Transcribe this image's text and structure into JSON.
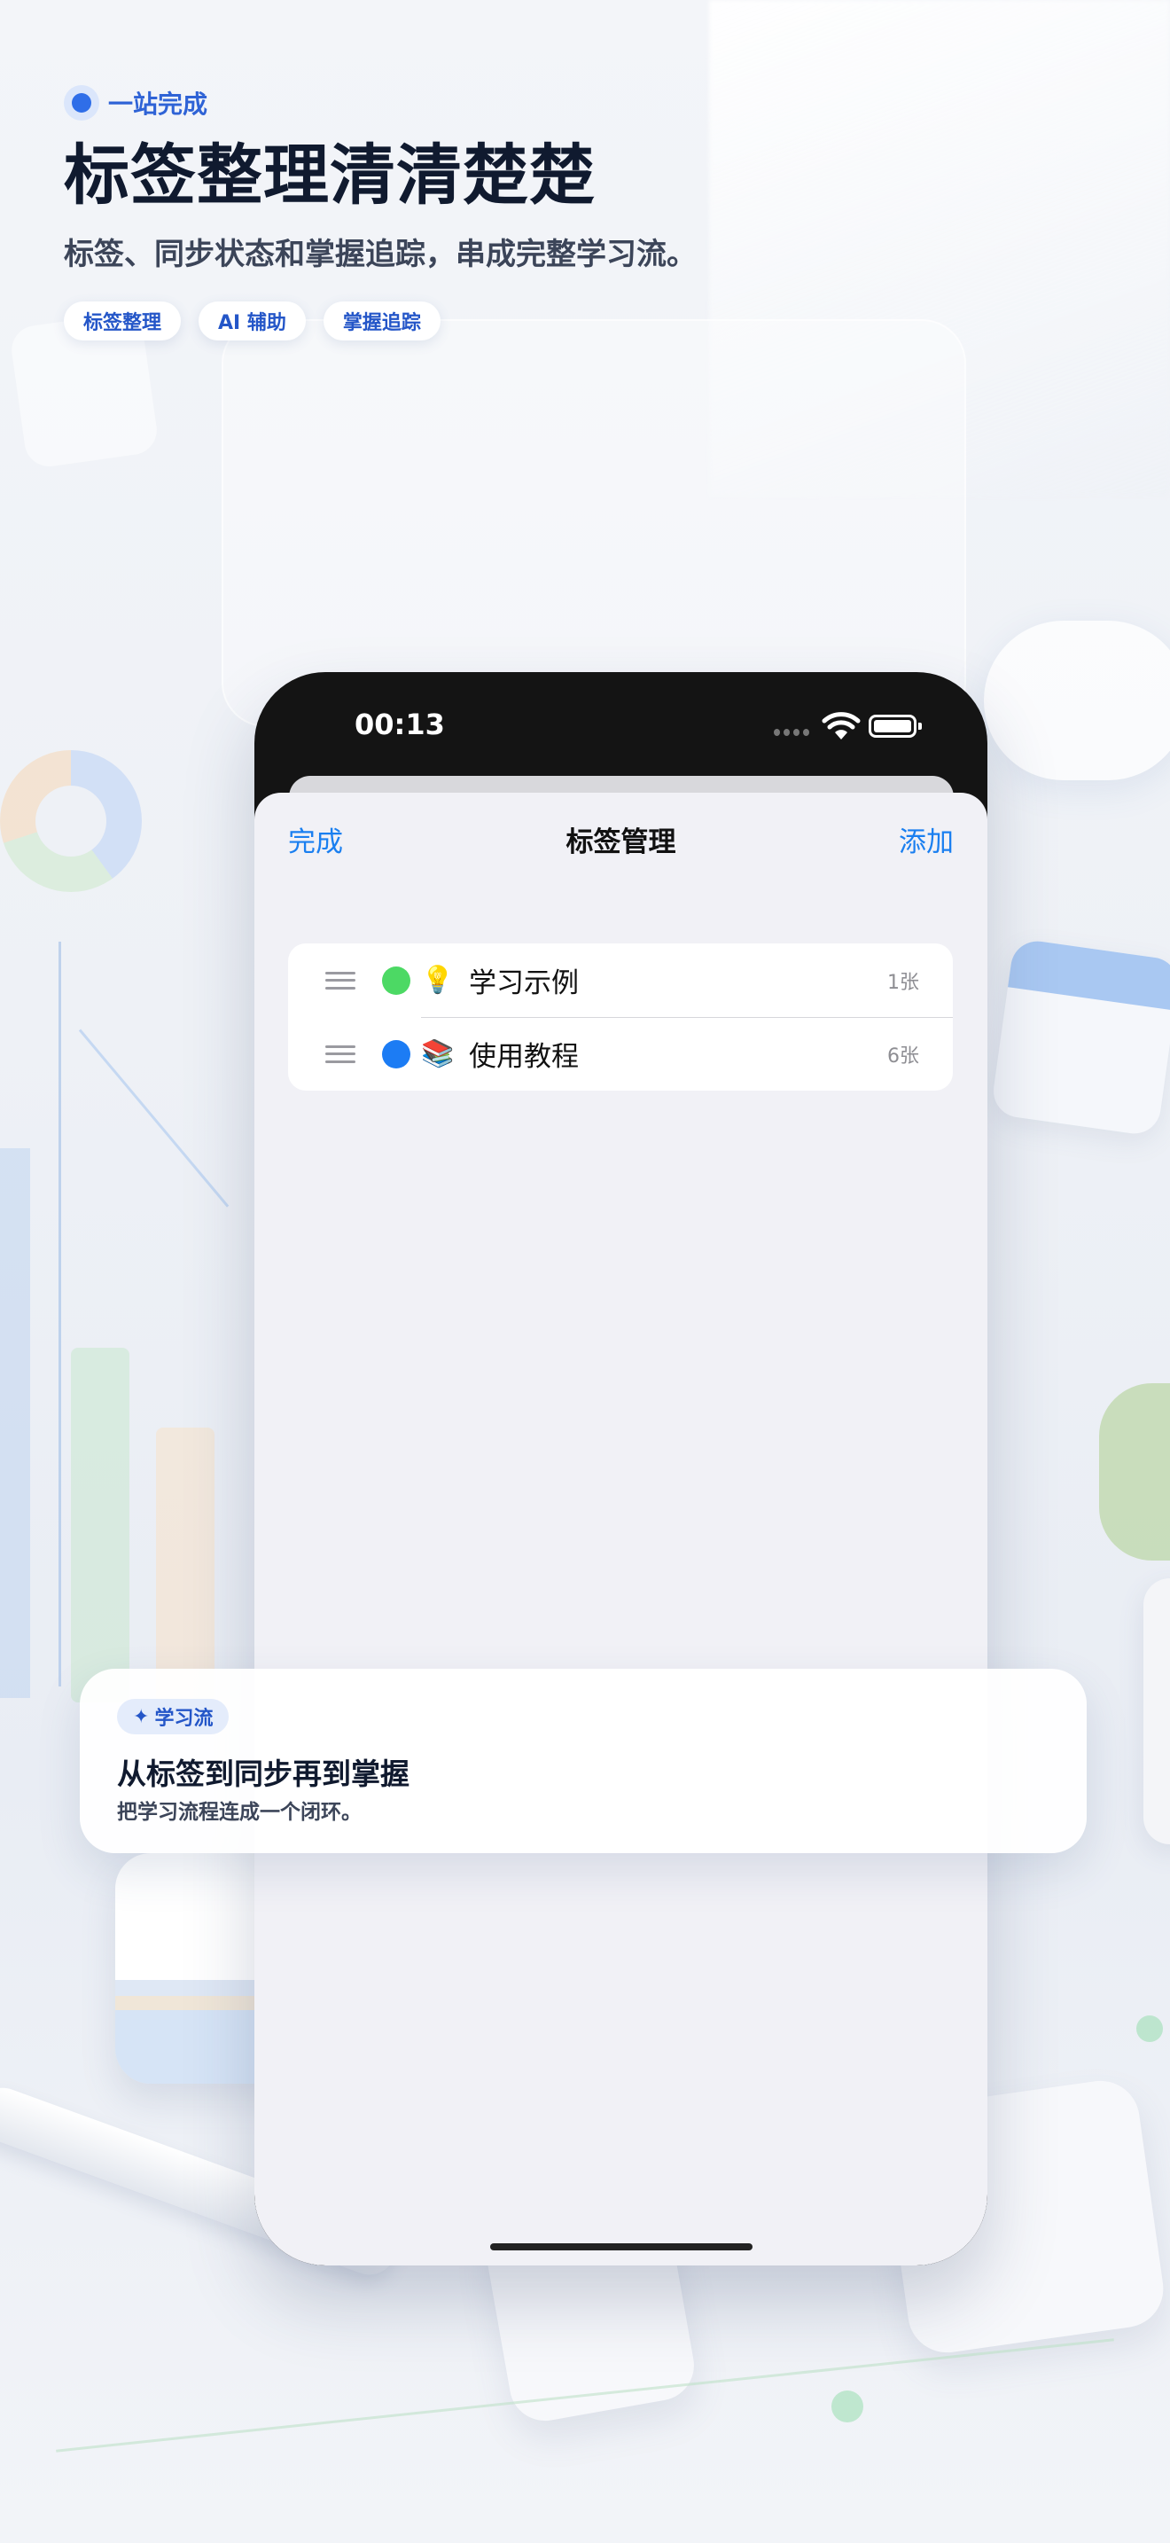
{
  "header": {
    "kicker": "一站完成",
    "headline": "标签整理清清楚楚",
    "subline": "标签、同步状态和掌握追踪，串成完整学习流。",
    "chips": [
      "标签整理",
      "AI 辅助",
      "掌握追踪"
    ]
  },
  "phone": {
    "status_time": "00:13",
    "navbar": {
      "done_label": "完成",
      "title": "标签管理",
      "add_label": "添加"
    },
    "tags": [
      {
        "color": "#4cd964",
        "emoji": "💡",
        "name": "学习示例",
        "count": "1张"
      },
      {
        "color": "#1c7cf4",
        "emoji": "📚",
        "name": "使用教程",
        "count": "6张"
      }
    ]
  },
  "card": {
    "badge_icon": "✦",
    "badge": "学习流",
    "title": "从标签到同步再到掌握",
    "desc": "把学习流程连成一个闭环。"
  },
  "colors": {
    "accent": "#2f6ee8",
    "ios_blue": "#1a7ff0"
  }
}
